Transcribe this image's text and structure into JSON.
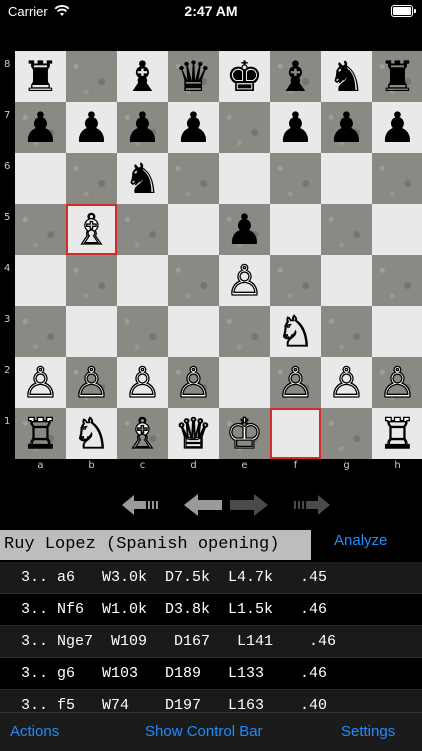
{
  "status_bar": {
    "carrier": "Carrier",
    "time": "2:47 AM"
  },
  "board": {
    "ranks": [
      "8",
      "7",
      "6",
      "5",
      "4",
      "3",
      "2",
      "1"
    ],
    "files": [
      "a",
      "b",
      "c",
      "d",
      "e",
      "f",
      "g",
      "h"
    ],
    "pieces": {
      "r8": [
        "♜",
        "",
        "♝",
        "♛",
        "♚",
        "♝",
        "♞",
        "♜"
      ],
      "r7": [
        "♟",
        "♟",
        "♟",
        "♟",
        "",
        "♟",
        "♟",
        "♟"
      ],
      "r6": [
        "",
        "",
        "♞",
        "",
        "",
        "",
        "",
        ""
      ],
      "r5": [
        "",
        "♗",
        "",
        "",
        "♟",
        "",
        "",
        ""
      ],
      "r4": [
        "",
        "",
        "",
        "",
        "♙",
        "",
        "",
        ""
      ],
      "r3": [
        "",
        "",
        "",
        "",
        "",
        "♘",
        "",
        ""
      ],
      "r2": [
        "♙",
        "♙",
        "♙",
        "♙",
        "",
        "♙",
        "♙",
        "♙"
      ],
      "r1": [
        "♖",
        "♘",
        "♗",
        "♕",
        "♔",
        "",
        "",
        "♖"
      ]
    },
    "highlight_squares": [
      "b5",
      "f1"
    ],
    "highlight_color": "#d42a2a"
  },
  "opening": {
    "name": "Ruy Lopez (Spanish opening)",
    "analyze_label": "Analyze"
  },
  "moves": [
    {
      "text": "3.. a6   W3.0k  D7.5k  L4.7k   .45"
    },
    {
      "text": "3.. Nf6  W1.0k  D3.8k  L1.5k   .46"
    },
    {
      "text": "3.. Nge7  W109   D167   L141    .46"
    },
    {
      "text": "3.. g6   W103   D189   L133    .46"
    },
    {
      "text": "3.. f5   W74    D197   L163    .40"
    }
  ],
  "toolbar": {
    "actions": "Actions",
    "show_control_bar": "Show Control Bar",
    "settings": "Settings"
  },
  "colors": {
    "accent": "#1e8cff",
    "opening_bar": "#bdbdbd"
  }
}
